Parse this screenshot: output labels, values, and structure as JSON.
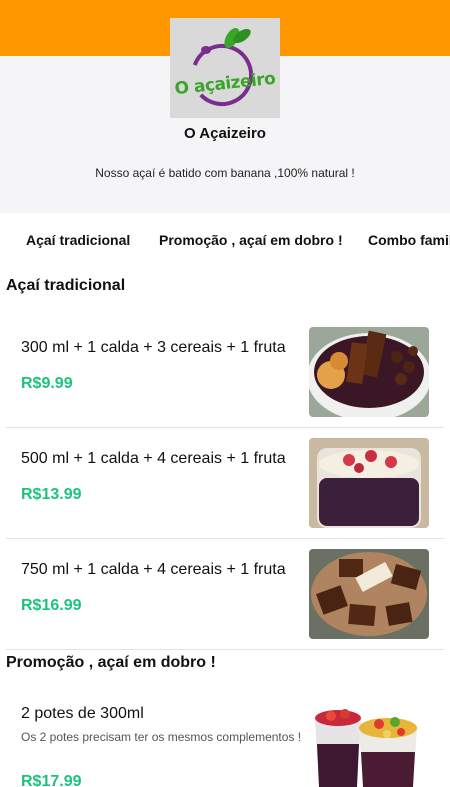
{
  "header": {
    "logo_text": "O açaizeiro",
    "store_name": "O Açaizeiro",
    "tagline": "Nosso açaí é batido com banana ,100% natural !"
  },
  "tabs": [
    {
      "label": "Açaí tradicional"
    },
    {
      "label": "Promoção , açaí em dobro !"
    },
    {
      "label": "Combo familia"
    }
  ],
  "sections": [
    {
      "title": "Açaí tradicional",
      "items": [
        {
          "name": "300 ml + 1 calda + 3 cereais + 1 fruta",
          "price": "R$9.99"
        },
        {
          "name": "500 ml + 1 calda + 4 cereais + 1 fruta",
          "price": "R$13.99"
        },
        {
          "name": "750 ml + 1 calda + 4 cereais + 1 fruta",
          "price": "R$16.99"
        }
      ]
    },
    {
      "title": "Promoção , açaí em dobro !",
      "items": [
        {
          "name": "2 potes de 300ml",
          "description": "Os 2 potes precisam ter os mesmos complementos !",
          "price": "R$17.99"
        }
      ]
    }
  ],
  "colors": {
    "topbar": "#ff9800",
    "header_bg": "#f5f5f7",
    "price": "#1bc47d",
    "logo_green": "#3aa629",
    "logo_purple": "#7b2d8e"
  }
}
